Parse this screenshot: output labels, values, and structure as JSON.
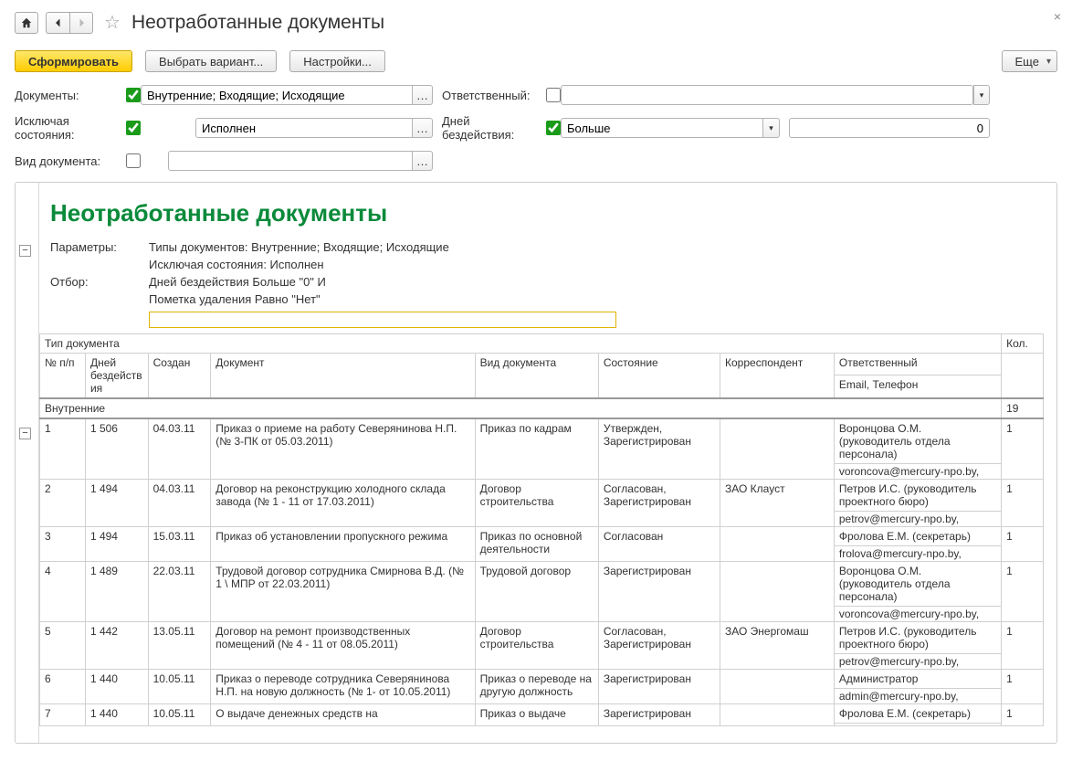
{
  "title": "Неотработанные документы",
  "toolbar": {
    "generate": "Сформировать",
    "choose_variant": "Выбрать вариант...",
    "settings": "Настройки...",
    "more": "Еще"
  },
  "filters": {
    "documents_label": "Документы:",
    "documents_checked": true,
    "documents_value": "Внутренние; Входящие; Исходящие",
    "responsible_label": "Ответственный:",
    "responsible_checked": false,
    "responsible_value": "",
    "excluding_states_label": "Исключая состояния:",
    "excluding_states_checked": true,
    "excluding_states_value": "Исполнен",
    "days_label": "Дней бездействия:",
    "days_checked": true,
    "days_op": "Больше",
    "days_value": "0",
    "doc_type_label": "Вид документа:",
    "doc_type_checked": false,
    "doc_type_value": ""
  },
  "report": {
    "heading": "Неотработанные документы",
    "meta": {
      "params_k": "Параметры:",
      "params_v1": "Типы документов: Внутренние; Входящие; Исходящие",
      "params_v2": "Исключая состояния: Исполнен",
      "filter_k": "Отбор:",
      "filter_v1": "Дней бездействия Больше \"0\" И",
      "filter_v2": "Пометка удаления Равно \"Нет\""
    },
    "head_top": {
      "doc_type": "Тип документа",
      "qty": "Кол."
    },
    "head": {
      "npp": "№ п/п",
      "days": "Дней бездействия",
      "created": "Создан",
      "doc": "Документ",
      "kind": "Вид документа",
      "state": "Состояние",
      "corr": "Корреспондент",
      "resp": "Ответственный",
      "resp2": "Email, Телефон"
    },
    "group": {
      "label": "Внутренние",
      "qty": "19"
    },
    "rows": [
      {
        "n": "1",
        "days": "1 506",
        "created": "04.03.11",
        "doc": "Приказ о приеме на работу Северянинова Н.П. (№ 3-ПК от 05.03.2011)",
        "kind": "Приказ по кадрам",
        "state": "Утвержден, Зарегистрирован",
        "corr": "",
        "resp": "Воронцова О.М. (руководитель отдела персонала)",
        "resp2": "voroncova@mercury-npo.by,",
        "q": "1"
      },
      {
        "n": "2",
        "days": "1 494",
        "created": "04.03.11",
        "doc": "Договор на реконструкцию холодного склада завода (№ 1 - 11 от 17.03.2011)",
        "kind": "Договор строительства",
        "state": "Согласован, Зарегистрирован",
        "corr": "ЗАО Клауст",
        "resp": "Петров И.С. (руководитель проектного бюро)",
        "resp2": "petrov@mercury-npo.by,",
        "q": "1"
      },
      {
        "n": "3",
        "days": "1 494",
        "created": "15.03.11",
        "doc": "Приказ об установлении пропускного режима",
        "kind": "Приказ по основной деятельности",
        "state": "Согласован",
        "corr": "",
        "resp": "Фролова Е.М. (секретарь)",
        "resp2": "frolova@mercury-npo.by,",
        "q": "1"
      },
      {
        "n": "4",
        "days": "1 489",
        "created": "22.03.11",
        "doc": "Трудовой договор сотрудника Смирнова В.Д. (№ 1 \\ МПР от 22.03.2011)",
        "kind": "Трудовой договор",
        "state": "Зарегистрирован",
        "corr": "",
        "resp": "Воронцова О.М. (руководитель отдела персонала)",
        "resp2": "voroncova@mercury-npo.by,",
        "q": "1"
      },
      {
        "n": "5",
        "days": "1 442",
        "created": "13.05.11",
        "doc": "Договор на ремонт производственных помещений (№ 4 - 11 от 08.05.2011)",
        "kind": "Договор строительства",
        "state": "Согласован, Зарегистрирован",
        "corr": "ЗАО Энергомаш",
        "resp": "Петров И.С. (руководитель проектного бюро)",
        "resp2": "petrov@mercury-npo.by,",
        "q": "1"
      },
      {
        "n": "6",
        "days": "1 440",
        "created": "10.05.11",
        "doc": "Приказ о переводе сотрудника Северянинова Н.П. на новую должность (№ 1- от 10.05.2011)",
        "kind": "Приказ о переводе на другую должность",
        "state": "Зарегистрирован",
        "corr": "",
        "resp": "Администратор",
        "resp2": "admin@mercury-npo.by,",
        "q": "1"
      },
      {
        "n": "7",
        "days": "1 440",
        "created": "10.05.11",
        "doc": "О выдаче денежных средств на",
        "kind": "Приказ о выдаче",
        "state": "Зарегистрирован",
        "corr": "",
        "resp": "Фролова Е.М. (секретарь)",
        "resp2": "",
        "q": "1"
      }
    ]
  }
}
